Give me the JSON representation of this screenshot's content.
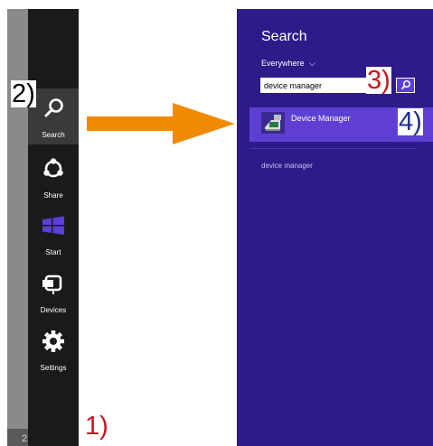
{
  "charms": {
    "items": [
      {
        "label": "Search",
        "icon": "search-icon"
      },
      {
        "label": "Share",
        "icon": "share-icon"
      },
      {
        "label": "Start",
        "icon": "windows-logo-icon"
      },
      {
        "label": "Devices",
        "icon": "devices-icon"
      },
      {
        "label": "Settings",
        "icon": "gear-icon"
      }
    ],
    "strip_number": "2"
  },
  "steps": {
    "step1": "1)",
    "step2": "2)",
    "step3": "3)",
    "step4": "4)"
  },
  "search_pane": {
    "title": "Search",
    "scope_label": "Everywhere",
    "scope_chevron": "⌵",
    "query": "device manager",
    "results": [
      {
        "label": "Device Manager",
        "icon": "device-manager-icon"
      }
    ],
    "suggestions": [
      "device manager"
    ]
  },
  "colors": {
    "pane_bg": "#2f1a8a",
    "result_highlight": "#5f3fd3",
    "charms_bg": "#1a1a1a",
    "arrow": "#f08a00",
    "step_red": "#c8141e",
    "step_navy": "#1b2f8f",
    "windows_logo": "#5b3fd6"
  }
}
